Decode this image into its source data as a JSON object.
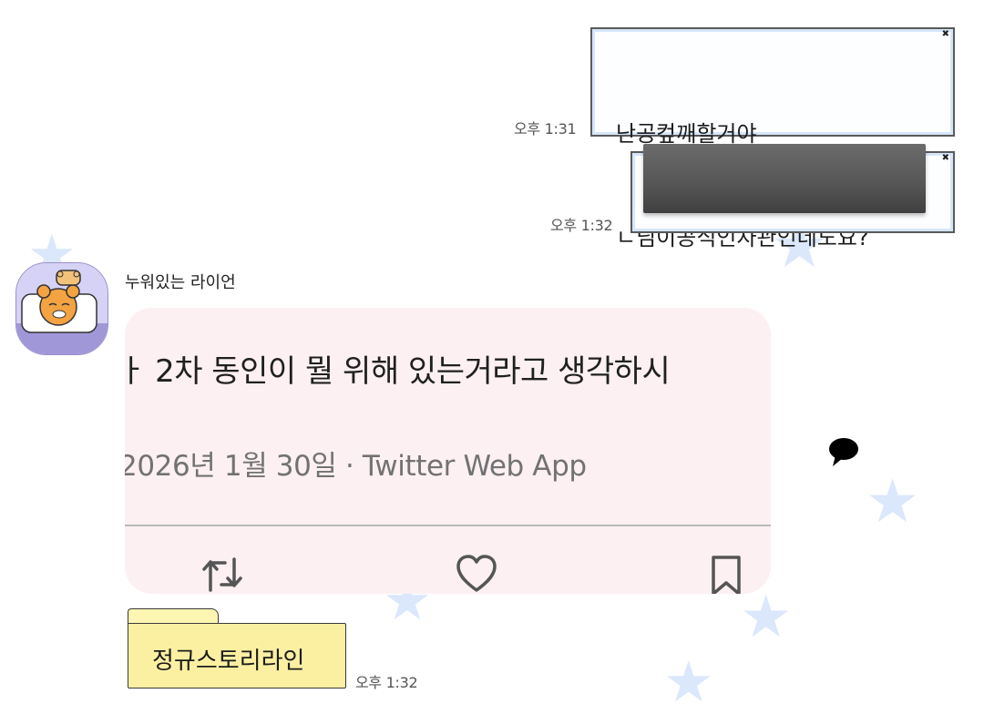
{
  "messages": {
    "out1": {
      "lines": [
        "난공컾깨할거야",
        "ㄴ님이공식인자관인데도요?"
      ],
      "time": "오후 1:31"
    },
    "out2": {
      "time": "오후 1:32"
    },
    "incoming": {
      "sender": "누워있는 라이언",
      "tweet": {
        "line1": "ㅏ 2차 동인이 뭘 위해 있는거라고 생각하시",
        "line2": "2026년 1월 30일 · Twitter Web App"
      },
      "reply_label": "정규스토리라인",
      "time": "오후 1:32"
    }
  },
  "icons": {
    "close": "close-icon",
    "retweet": "retweet-icon",
    "like": "heart-icon",
    "bookmark": "bookmark-icon",
    "speech": "speech-bubble-icon",
    "avatar": "ryan-character-avatar"
  },
  "colors": {
    "bubble_border": "#5a5a5a",
    "bubble_inner": "#d6e6fb",
    "tweet_bg": "#fcf0f2",
    "folder_bg": "#fbf0a2",
    "star": "#dbe7fb"
  }
}
